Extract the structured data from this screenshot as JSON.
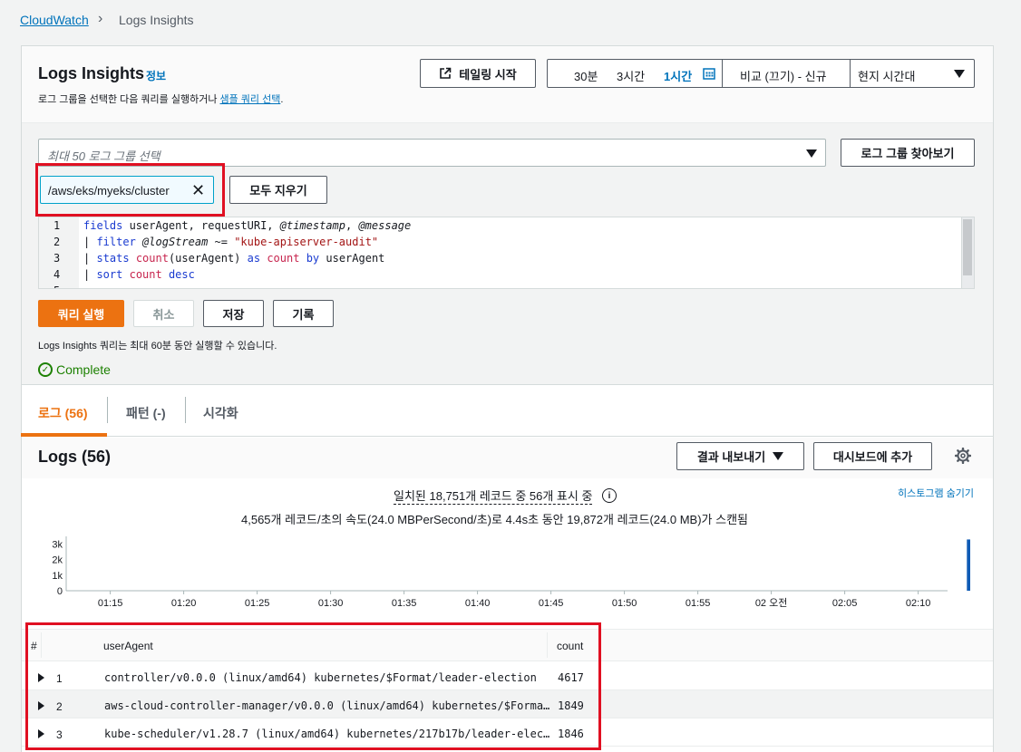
{
  "breadcrumb": {
    "root": "CloudWatch",
    "current": "Logs Insights"
  },
  "header": {
    "title": "Logs Insights",
    "info": "정보",
    "subtitle_prefix": "로그 그룹을 선택한 다음 쿼리를 실행하거나 ",
    "subtitle_link": "샘플 쿼리 선택",
    "subtitle_suffix": "."
  },
  "toolbar": {
    "tail_label": "테일링 시작",
    "time_options": [
      "30분",
      "3시간",
      "1시간"
    ],
    "time_selected": "1시간",
    "compare": "비교 (끄기) - 신규",
    "timezone": "현지 시간대"
  },
  "log_groups": {
    "placeholder": "최대 50 로그 그룹 선택",
    "browse_label": "로그 그룹 찾아보기",
    "selected": "/aws/eks/myeks/cluster",
    "clear_label": "모두 지우기"
  },
  "editor": {
    "line_numbers": [
      "1",
      "2",
      "3",
      "4",
      "5"
    ]
  },
  "actions": {
    "run": "쿼리 실행",
    "cancel": "취소",
    "save": "저장",
    "history": "기록",
    "note": "Logs Insights 쿼리는 최대 60분 동안 실행할 수 있습니다.",
    "status": "Complete"
  },
  "tabs": {
    "logs": "로그 (56)",
    "patterns": "패턴 (-)",
    "visualize": "시각화"
  },
  "logs": {
    "title": "Logs (56)",
    "export_label": "결과 내보내기",
    "dashboard_label": "대시보드에 추가",
    "match_text": "일치된 18,751개 레코드 중 56개 표시 중",
    "rate_text": "4,565개 레코드/초의 속도(24.0 MBPerSecond/초)로 4.4s초 동안 19,872개 레코드(24.0 MB)가 스캔됨",
    "hide_histogram": "히스토그램 숨기기"
  },
  "chart_data": {
    "type": "bar",
    "x_ticks": [
      "01:15",
      "01:20",
      "01:25",
      "01:30",
      "01:35",
      "01:40",
      "01:45",
      "01:50",
      "01:55",
      "02 오전",
      "02:05",
      "02:10"
    ],
    "y_ticks": [
      "3k",
      "2k",
      "1k",
      "0"
    ],
    "ylim": [
      0,
      3500
    ],
    "bars": [
      {
        "x_minutes_after_0115": 58.5,
        "value": 3300
      }
    ],
    "bar_color": "#0f5bb5"
  },
  "table": {
    "columns": [
      "#",
      "userAgent",
      "count"
    ],
    "rows": [
      {
        "num": "1",
        "userAgent": "controller/v0.0.0 (linux/amd64) kubernetes/$Format/leader-election",
        "count": "4617"
      },
      {
        "num": "2",
        "userAgent": "aws-cloud-controller-manager/v0.0.0 (linux/amd64) kubernetes/$Forma…",
        "count": "1849"
      },
      {
        "num": "3",
        "userAgent": "kube-scheduler/v1.28.7 (linux/amd64) kubernetes/217b17b/leader-elec…",
        "count": "1846"
      }
    ]
  },
  "colors": {
    "accent": "#ec7211",
    "link": "#0073bb",
    "highlight": "#e01022",
    "success": "#1d8102"
  }
}
